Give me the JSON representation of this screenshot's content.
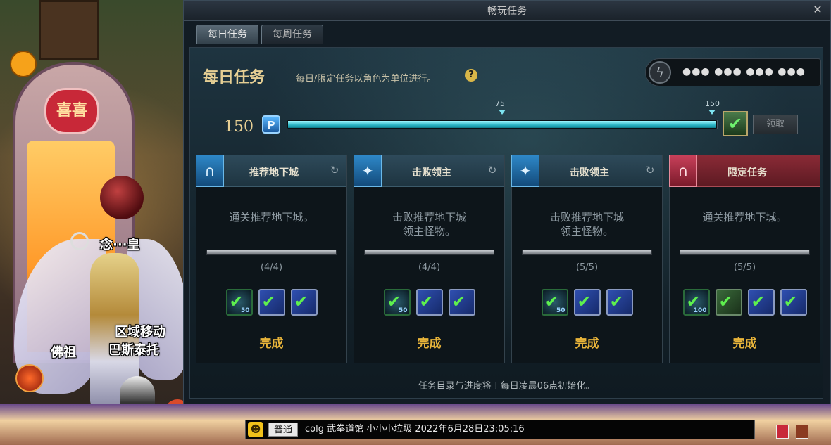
{
  "window": {
    "title": "畅玩任务",
    "close_glyph": "✕"
  },
  "tabs": [
    {
      "label": "每日任务",
      "active": true
    },
    {
      "label": "每周任务",
      "active": false
    }
  ],
  "header": {
    "title": "每日任务",
    "subtitle": "每日/限定任务以角色为单位进行。",
    "help_glyph": "?",
    "fatigue": {
      "icon": "lightning-icon",
      "value": "●●● ●●● ●●● ●●●"
    }
  },
  "progress": {
    "score": "150",
    "point_glyph": "P",
    "current": 150,
    "max": 150,
    "milestones": [
      {
        "label": "75",
        "value": 75
      },
      {
        "label": "150",
        "value": 150
      }
    ],
    "chest_glyph": "✔",
    "claim_label": "领取"
  },
  "cards": [
    {
      "title": "推荐地下城",
      "icon": "gate-icon",
      "badge_glyph": "∩",
      "variant": "normal",
      "description": "通关推荐地下城。",
      "progress": "(4/4)",
      "status": "完成",
      "rewards": [
        {
          "type": "emblem",
          "num": "50"
        },
        {
          "type": "box",
          "num": ""
        },
        {
          "type": "box",
          "num": ""
        }
      ]
    },
    {
      "title": "击败领主",
      "icon": "sword-icon",
      "badge_glyph": "✦",
      "variant": "normal",
      "description": "击败推荐地下城\n领主怪物。",
      "progress": "(4/4)",
      "status": "完成",
      "rewards": [
        {
          "type": "emblem",
          "num": "50"
        },
        {
          "type": "box",
          "num": ""
        },
        {
          "type": "box",
          "num": ""
        }
      ]
    },
    {
      "title": "击败领主",
      "icon": "sword-icon",
      "badge_glyph": "✦",
      "variant": "normal",
      "description": "击败推荐地下城\n领主怪物。",
      "progress": "(5/5)",
      "status": "完成",
      "rewards": [
        {
          "type": "emblem",
          "num": "50"
        },
        {
          "type": "box",
          "num": ""
        },
        {
          "type": "box",
          "num": ""
        }
      ]
    },
    {
      "title": "限定任务",
      "icon": "gate-icon",
      "badge_glyph": "∩",
      "variant": "limited",
      "description": "通关推荐地下城。",
      "progress": "(5/5)",
      "status": "完成",
      "rewards": [
        {
          "type": "emblem",
          "num": "100"
        },
        {
          "type": "green",
          "num": ""
        },
        {
          "type": "box",
          "num": ""
        },
        {
          "type": "box",
          "num": ""
        }
      ]
    }
  ],
  "footer": "任务目录与进度将于每日凌晨06点初始化。",
  "scene": {
    "heart_sign": "喜喜",
    "player_name": "念···皇",
    "player_title": "区域移动",
    "player_location": "巴斯泰托",
    "npc_name": "佛祖"
  },
  "chat": {
    "emote_glyph": "☻",
    "channel": "普通",
    "text": "colg 武拳道馆 小小小垃圾 2022年6月28日23:05:16"
  },
  "colors": {
    "accent_gold": "#e6cf94",
    "progress_cyan": "#2ab4c4",
    "complete_orange": "#e8b43a",
    "limited_red": "#8a2a36"
  }
}
